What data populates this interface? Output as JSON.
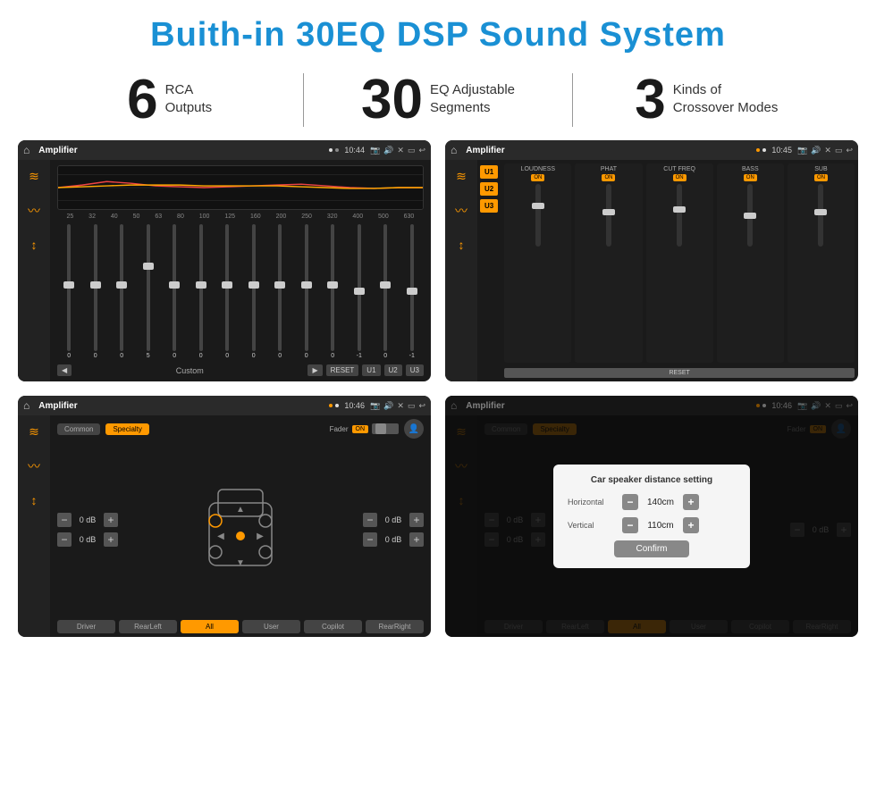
{
  "page": {
    "title": "Buith-in 30EQ DSP Sound System",
    "stats": [
      {
        "number": "6",
        "label": "RCA\nOutputs"
      },
      {
        "number": "30",
        "label": "EQ Adjustable\nSegments"
      },
      {
        "number": "3",
        "label": "Kinds of\nCrossover Modes"
      }
    ]
  },
  "screen1": {
    "topbar": {
      "title": "Amplifier",
      "time": "10:44"
    },
    "freqs": [
      "25",
      "32",
      "40",
      "50",
      "63",
      "80",
      "100",
      "125",
      "160",
      "200",
      "250",
      "320",
      "400",
      "500",
      "630"
    ],
    "values": [
      "0",
      "0",
      "0",
      "5",
      "0",
      "0",
      "0",
      "0",
      "0",
      "0",
      "0",
      "-1",
      "0",
      "-1"
    ],
    "preset": "Custom",
    "btns": [
      "RESET",
      "U1",
      "U2",
      "U3"
    ]
  },
  "screen2": {
    "topbar": {
      "title": "Amplifier",
      "time": "10:45"
    },
    "presets": [
      "U1",
      "U2",
      "U3"
    ],
    "channels": [
      "LOUDNESS",
      "PHAT",
      "CUT FREQ",
      "BASS",
      "SUB"
    ],
    "reset_label": "RESET"
  },
  "screen3": {
    "topbar": {
      "title": "Amplifier",
      "time": "10:46"
    },
    "tabs": [
      "Common",
      "Specialty"
    ],
    "fader_label": "Fader",
    "fader_on": "ON",
    "db_values": [
      "0 dB",
      "0 dB",
      "0 dB",
      "0 dB"
    ],
    "btns": [
      "Driver",
      "Copilot",
      "RearLeft",
      "All",
      "User",
      "RearRight"
    ]
  },
  "screen4": {
    "topbar": {
      "title": "Amplifier",
      "time": "10:46"
    },
    "tabs": [
      "Common",
      "Specialty"
    ],
    "dialog": {
      "title": "Car speaker distance setting",
      "horizontal_label": "Horizontal",
      "horizontal_value": "140cm",
      "vertical_label": "Vertical",
      "vertical_value": "110cm",
      "confirm_label": "Confirm"
    },
    "db_values": [
      "0 dB",
      "0 dB"
    ],
    "btns": [
      "Driver",
      "Copilot",
      "RearLeft",
      "All",
      "User",
      "RearRight"
    ]
  },
  "icons": {
    "home": "⌂",
    "back": "↩",
    "volume": "♪",
    "settings": "⚙",
    "sliders": "≡",
    "wave": "〰",
    "arrows": "↕"
  }
}
